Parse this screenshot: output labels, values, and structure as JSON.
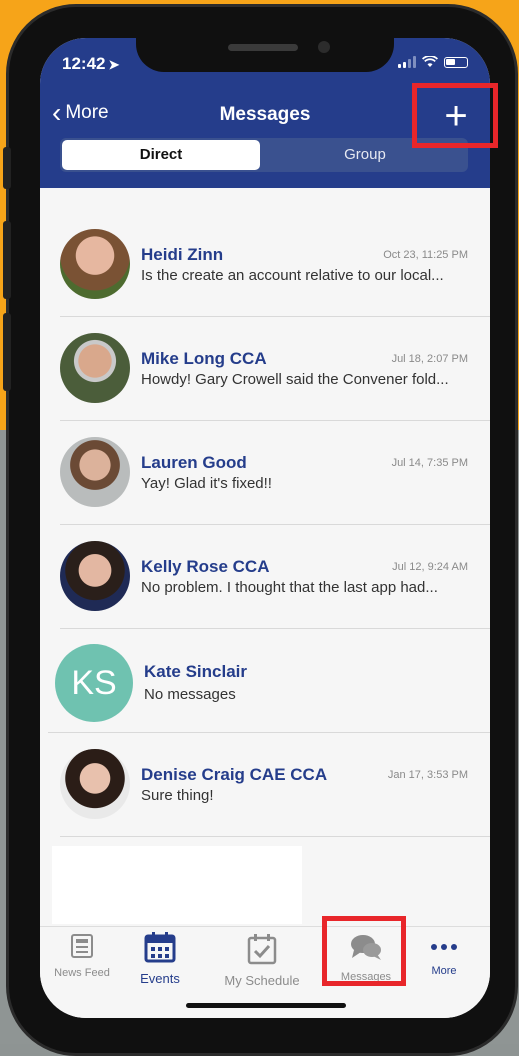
{
  "status_bar": {
    "time": "12:42",
    "location_arrow": "➤"
  },
  "nav": {
    "back_label": "More",
    "title": "Messages",
    "add_icon": "+"
  },
  "segments": {
    "direct": "Direct",
    "group": "Group"
  },
  "conversations": [
    {
      "name": "Heidi Zinn",
      "time": "Oct 23, 11:25 PM",
      "preview": "Is the create an account relative to our local..."
    },
    {
      "name": "Mike Long CCA",
      "time": "Jul 18, 2:07 PM",
      "preview": "Howdy!  Gary Crowell said the Convener fold..."
    },
    {
      "name": "Lauren Good",
      "time": "Jul 14, 7:35 PM",
      "preview": "Yay! Glad it's fixed!!"
    },
    {
      "name": "Kelly Rose CCA",
      "time": "Jul 12, 9:24 AM",
      "preview": "No problem.  I thought that the last app had..."
    },
    {
      "name": "Kate Sinclair",
      "initials": "KS",
      "time": "",
      "preview": "No messages"
    },
    {
      "name": "Denise Craig CAE CCA",
      "time": "Jan 17, 3:53 PM",
      "preview": "Sure thing!"
    }
  ],
  "tabs": [
    {
      "label": "News Feed",
      "icon": "news-feed-icon"
    },
    {
      "label": "Events",
      "icon": "calendar-icon"
    },
    {
      "label": "My Schedule",
      "icon": "schedule-icon"
    },
    {
      "label": "Messages",
      "icon": "chat-bubbles-icon"
    },
    {
      "label": "More",
      "icon": "more-dots-icon"
    }
  ],
  "colors": {
    "nav_bg": "#253d8b",
    "accent": "#253d8b",
    "highlight": "#e8262a",
    "kate_avatar": "#6fc2b0"
  }
}
